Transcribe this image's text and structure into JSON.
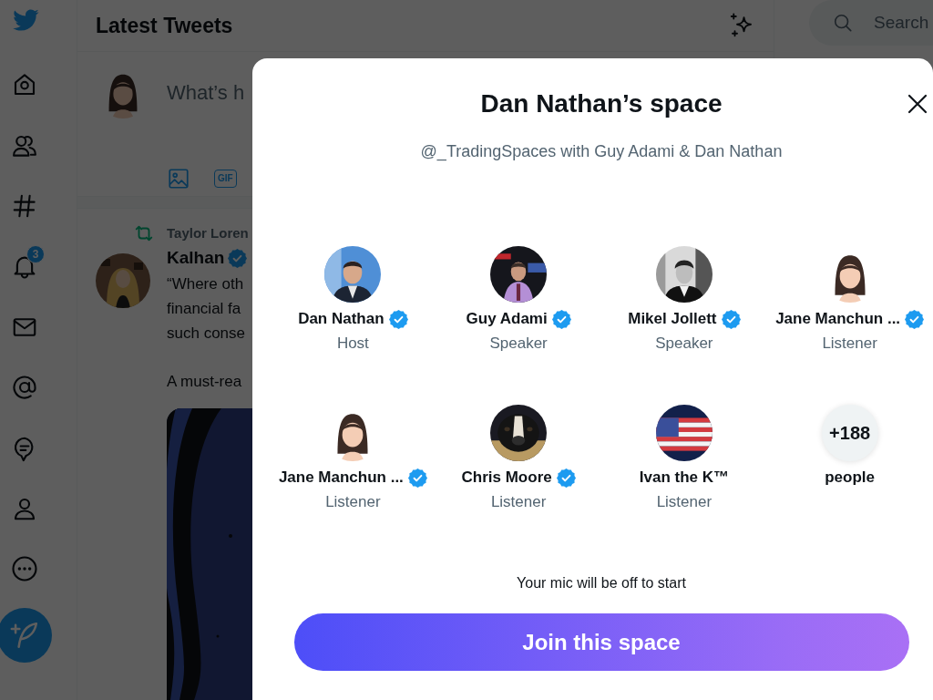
{
  "nav": {
    "badge": "3"
  },
  "header": {
    "title": "Latest Tweets"
  },
  "search": {
    "placeholder": "Search"
  },
  "compose": {
    "placeholder": "What’s h",
    "gif_label": "GIF"
  },
  "tweet": {
    "retweeted_by": "Taylor Loren",
    "author": "Kalhan",
    "verified": true,
    "lines": [
      "“Where oth",
      "financial fa",
      "such conse"
    ],
    "second_paragraph": "A must-rea"
  },
  "space": {
    "title": "Dan Nathan’s space",
    "subtitle": "@_TradingSpaces with Guy Adami & Dan Nathan",
    "participants": [
      {
        "kind": "person",
        "name": "Dan Nathan",
        "verified": true,
        "role": "Host"
      },
      {
        "kind": "person",
        "name": "Guy Adami",
        "verified": true,
        "role": "Speaker"
      },
      {
        "kind": "person",
        "name": "Mikel Jollett",
        "verified": true,
        "role": "Speaker"
      },
      {
        "kind": "person",
        "name": "Jane Manchun ...",
        "verified": true,
        "role": "Listener"
      },
      {
        "kind": "person",
        "name": "Jane Manchun ...",
        "verified": true,
        "role": "Listener"
      },
      {
        "kind": "person",
        "name": "Chris Moore",
        "verified": true,
        "role": "Listener"
      },
      {
        "kind": "person",
        "name": "Ivan the K™",
        "verified": false,
        "role": "Listener"
      },
      {
        "kind": "more",
        "count": "+188",
        "label": "people"
      }
    ],
    "note": "Your mic will be off to start",
    "join_button": "Join this space"
  }
}
